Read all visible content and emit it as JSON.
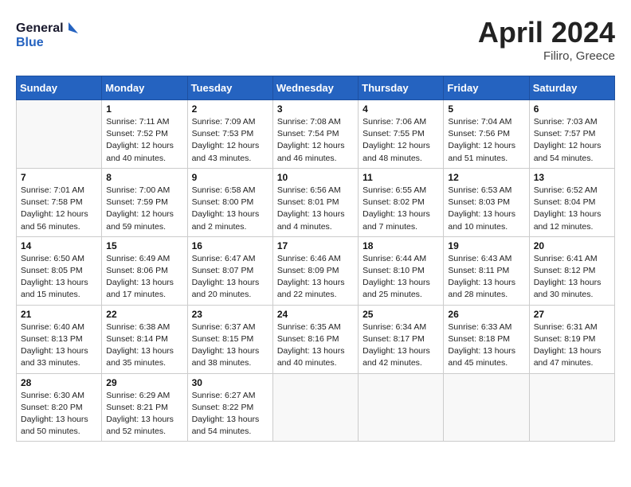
{
  "header": {
    "logo_line1": "General",
    "logo_line2": "Blue",
    "month_title": "April 2024",
    "location": "Filiro, Greece"
  },
  "days_of_week": [
    "Sunday",
    "Monday",
    "Tuesday",
    "Wednesday",
    "Thursday",
    "Friday",
    "Saturday"
  ],
  "weeks": [
    [
      {
        "day": "",
        "info": ""
      },
      {
        "day": "1",
        "info": "Sunrise: 7:11 AM\nSunset: 7:52 PM\nDaylight: 12 hours\nand 40 minutes."
      },
      {
        "day": "2",
        "info": "Sunrise: 7:09 AM\nSunset: 7:53 PM\nDaylight: 12 hours\nand 43 minutes."
      },
      {
        "day": "3",
        "info": "Sunrise: 7:08 AM\nSunset: 7:54 PM\nDaylight: 12 hours\nand 46 minutes."
      },
      {
        "day": "4",
        "info": "Sunrise: 7:06 AM\nSunset: 7:55 PM\nDaylight: 12 hours\nand 48 minutes."
      },
      {
        "day": "5",
        "info": "Sunrise: 7:04 AM\nSunset: 7:56 PM\nDaylight: 12 hours\nand 51 minutes."
      },
      {
        "day": "6",
        "info": "Sunrise: 7:03 AM\nSunset: 7:57 PM\nDaylight: 12 hours\nand 54 minutes."
      }
    ],
    [
      {
        "day": "7",
        "info": "Sunrise: 7:01 AM\nSunset: 7:58 PM\nDaylight: 12 hours\nand 56 minutes."
      },
      {
        "day": "8",
        "info": "Sunrise: 7:00 AM\nSunset: 7:59 PM\nDaylight: 12 hours\nand 59 minutes."
      },
      {
        "day": "9",
        "info": "Sunrise: 6:58 AM\nSunset: 8:00 PM\nDaylight: 13 hours\nand 2 minutes."
      },
      {
        "day": "10",
        "info": "Sunrise: 6:56 AM\nSunset: 8:01 PM\nDaylight: 13 hours\nand 4 minutes."
      },
      {
        "day": "11",
        "info": "Sunrise: 6:55 AM\nSunset: 8:02 PM\nDaylight: 13 hours\nand 7 minutes."
      },
      {
        "day": "12",
        "info": "Sunrise: 6:53 AM\nSunset: 8:03 PM\nDaylight: 13 hours\nand 10 minutes."
      },
      {
        "day": "13",
        "info": "Sunrise: 6:52 AM\nSunset: 8:04 PM\nDaylight: 13 hours\nand 12 minutes."
      }
    ],
    [
      {
        "day": "14",
        "info": "Sunrise: 6:50 AM\nSunset: 8:05 PM\nDaylight: 13 hours\nand 15 minutes."
      },
      {
        "day": "15",
        "info": "Sunrise: 6:49 AM\nSunset: 8:06 PM\nDaylight: 13 hours\nand 17 minutes."
      },
      {
        "day": "16",
        "info": "Sunrise: 6:47 AM\nSunset: 8:07 PM\nDaylight: 13 hours\nand 20 minutes."
      },
      {
        "day": "17",
        "info": "Sunrise: 6:46 AM\nSunset: 8:09 PM\nDaylight: 13 hours\nand 22 minutes."
      },
      {
        "day": "18",
        "info": "Sunrise: 6:44 AM\nSunset: 8:10 PM\nDaylight: 13 hours\nand 25 minutes."
      },
      {
        "day": "19",
        "info": "Sunrise: 6:43 AM\nSunset: 8:11 PM\nDaylight: 13 hours\nand 28 minutes."
      },
      {
        "day": "20",
        "info": "Sunrise: 6:41 AM\nSunset: 8:12 PM\nDaylight: 13 hours\nand 30 minutes."
      }
    ],
    [
      {
        "day": "21",
        "info": "Sunrise: 6:40 AM\nSunset: 8:13 PM\nDaylight: 13 hours\nand 33 minutes."
      },
      {
        "day": "22",
        "info": "Sunrise: 6:38 AM\nSunset: 8:14 PM\nDaylight: 13 hours\nand 35 minutes."
      },
      {
        "day": "23",
        "info": "Sunrise: 6:37 AM\nSunset: 8:15 PM\nDaylight: 13 hours\nand 38 minutes."
      },
      {
        "day": "24",
        "info": "Sunrise: 6:35 AM\nSunset: 8:16 PM\nDaylight: 13 hours\nand 40 minutes."
      },
      {
        "day": "25",
        "info": "Sunrise: 6:34 AM\nSunset: 8:17 PM\nDaylight: 13 hours\nand 42 minutes."
      },
      {
        "day": "26",
        "info": "Sunrise: 6:33 AM\nSunset: 8:18 PM\nDaylight: 13 hours\nand 45 minutes."
      },
      {
        "day": "27",
        "info": "Sunrise: 6:31 AM\nSunset: 8:19 PM\nDaylight: 13 hours\nand 47 minutes."
      }
    ],
    [
      {
        "day": "28",
        "info": "Sunrise: 6:30 AM\nSunset: 8:20 PM\nDaylight: 13 hours\nand 50 minutes."
      },
      {
        "day": "29",
        "info": "Sunrise: 6:29 AM\nSunset: 8:21 PM\nDaylight: 13 hours\nand 52 minutes."
      },
      {
        "day": "30",
        "info": "Sunrise: 6:27 AM\nSunset: 8:22 PM\nDaylight: 13 hours\nand 54 minutes."
      },
      {
        "day": "",
        "info": ""
      },
      {
        "day": "",
        "info": ""
      },
      {
        "day": "",
        "info": ""
      },
      {
        "day": "",
        "info": ""
      }
    ]
  ]
}
